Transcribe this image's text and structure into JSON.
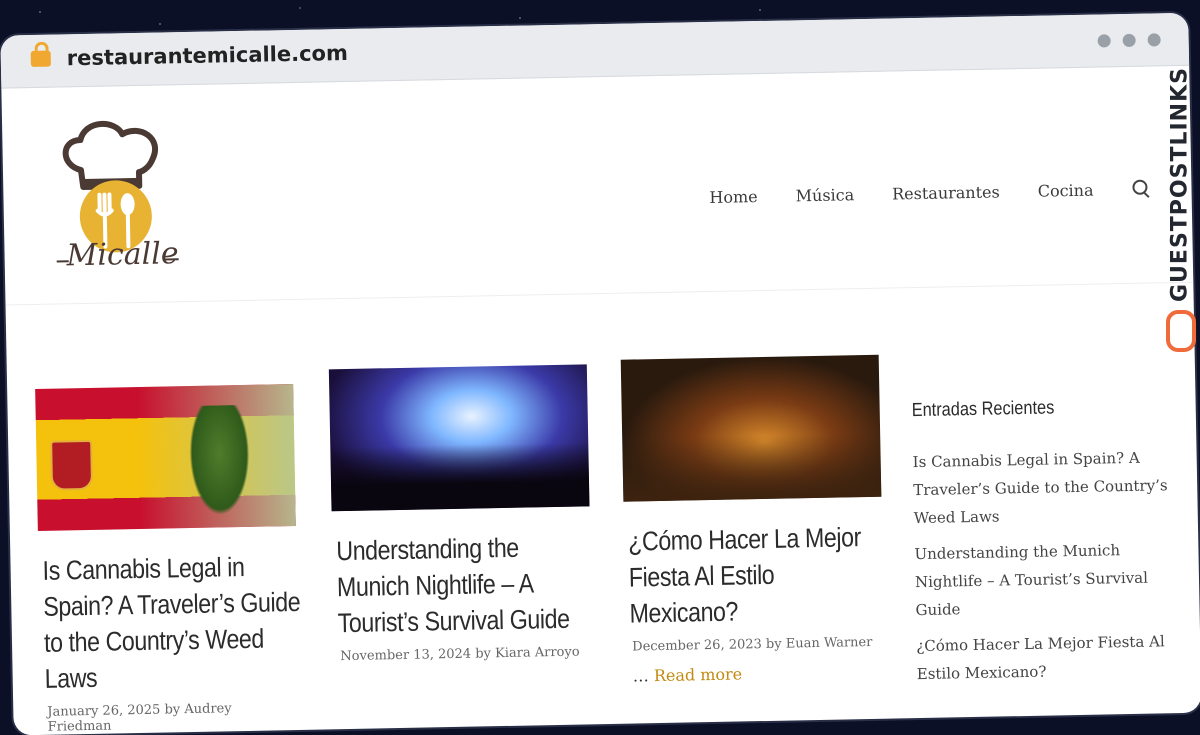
{
  "browser": {
    "url": "restaurantemicalle.com"
  },
  "site": {
    "logo_text": "Micalle",
    "nav": [
      "Home",
      "Música",
      "Restaurantes",
      "Cocina"
    ]
  },
  "posts": [
    {
      "title": "Is Cannabis Legal in Spain? A Traveler’s Guide to the Country’s Weed Laws",
      "date": "January 26, 2025",
      "author": "Audrey Friedman"
    },
    {
      "title": "Understanding the Munich Nightlife – A Tourist’s Survival Guide",
      "date": "November 13, 2024",
      "author": "Kiara Arroyo"
    },
    {
      "title": "¿Cómo Hacer La Mejor Fiesta Al Estilo Mexicano?",
      "date": "December 26, 2023",
      "author": "Euan Warner",
      "excerpt_prefix": "…",
      "read_more": "Read more"
    }
  ],
  "sidebar": {
    "heading": "Entradas Recientes",
    "items": [
      "Is Cannabis Legal in Spain? A Traveler’s Guide to the Country’s Weed Laws",
      "Understanding the Munich Nightlife – A Tourist’s Survival Guide",
      "¿Cómo Hacer La Mejor Fiesta Al Estilo Mexicano?"
    ]
  },
  "badge": {
    "text": "GUESTPOSTLINKS"
  },
  "colors": {
    "accent": "#c28a11",
    "lock": "#f0a830",
    "badge_icon": "#f06b3a"
  }
}
